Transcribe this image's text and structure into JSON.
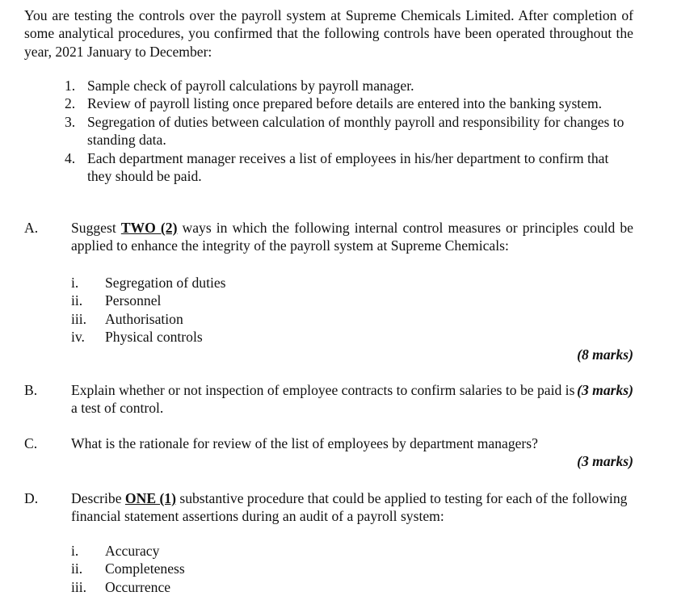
{
  "document": {
    "intro": {
      "text": "You are testing the controls over the payroll system at Supreme Chemicals Limited. After completion of some analytical procedures, you confirmed that the following controls have been operated throughout the year, 2021 January to December:"
    },
    "controls_list": {
      "markers": [
        "1.",
        "2.",
        "3.",
        "4."
      ],
      "items": [
        "Sample check of payroll calculations by payroll manager.",
        "Review of payroll listing once prepared before details are entered into the banking system.",
        "Segregation of duties between calculation of monthly payroll and responsibility for changes to standing data.",
        "Each department manager receives a list of employees in his/her department to confirm that they should be paid."
      ]
    },
    "sections": {
      "a": {
        "letter": "A.",
        "text_before_emph": "Suggest ",
        "emph": "TWO (2)",
        "text_after_emph": " ways in which the following internal control measures or principles could be applied to enhance the integrity of the payroll system at Supreme Chemicals:",
        "sub_markers": [
          "i.",
          "ii.",
          "iii.",
          "iv."
        ],
        "sub_items": [
          "Segregation of duties",
          "Personnel",
          "Authorisation",
          "Physical controls"
        ],
        "marks": "(8 marks)"
      },
      "b": {
        "letter": "B.",
        "text": "Explain whether or not inspection of employee contracts to confirm salaries to be paid is a test of control.",
        "marks": "(3 marks)"
      },
      "c": {
        "letter": "C.",
        "text": "What is the rationale for review of the list of employees by department managers?",
        "marks": "(3 marks)"
      },
      "d": {
        "letter": "D.",
        "text_before_emph": "Describe ",
        "emph": "ONE (1)",
        "text_after_emph": " substantive procedure that could be applied to testing for each of the following financial statement assertions during an audit of a payroll system:",
        "sub_markers": [
          "i.",
          "ii.",
          "iii."
        ],
        "sub_items": [
          "Accuracy",
          "Completeness",
          "Occurrence"
        ]
      }
    }
  }
}
